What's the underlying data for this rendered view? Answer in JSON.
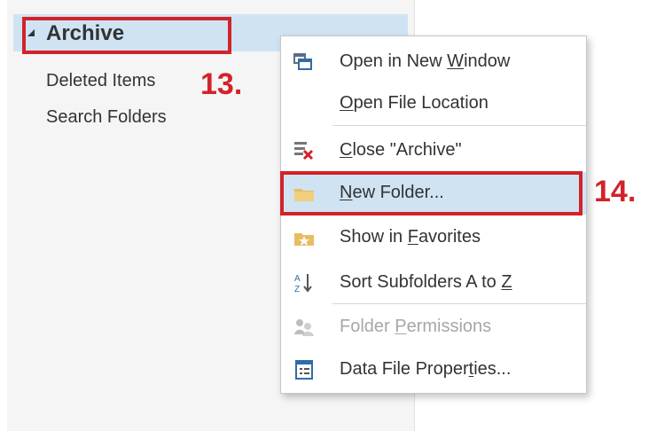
{
  "folder_pane": {
    "archive": "Archive",
    "items": [
      "Deleted Items",
      "Search Folders"
    ]
  },
  "annotations": {
    "step_13": "13.",
    "step_14": "14.",
    "color": "#d2232a"
  },
  "context_menu": {
    "items": [
      {
        "label": "Open in New Window",
        "icon": "open-window-icon",
        "enabled": true
      },
      {
        "label": "Open File Location",
        "icon": null,
        "enabled": true
      },
      {
        "label": "Close \"Archive\"",
        "icon": "close-archive-icon",
        "enabled": true
      },
      {
        "label": "New Folder...",
        "icon": "new-folder-icon",
        "enabled": true,
        "selected": true
      },
      {
        "label": "Show in Favorites",
        "icon": "favorites-icon",
        "enabled": true
      },
      {
        "label": "Sort Subfolders A to Z",
        "icon": "sort-a-to-z-icon",
        "enabled": true
      },
      {
        "label": "Folder Permissions",
        "icon": "permissions-icon",
        "enabled": false
      },
      {
        "label": "Data File Properties...",
        "icon": "properties-icon",
        "enabled": true
      }
    ],
    "accent_colors": {
      "selection": "#cfe3f3",
      "disabled_text": "#a7a7a7"
    }
  }
}
